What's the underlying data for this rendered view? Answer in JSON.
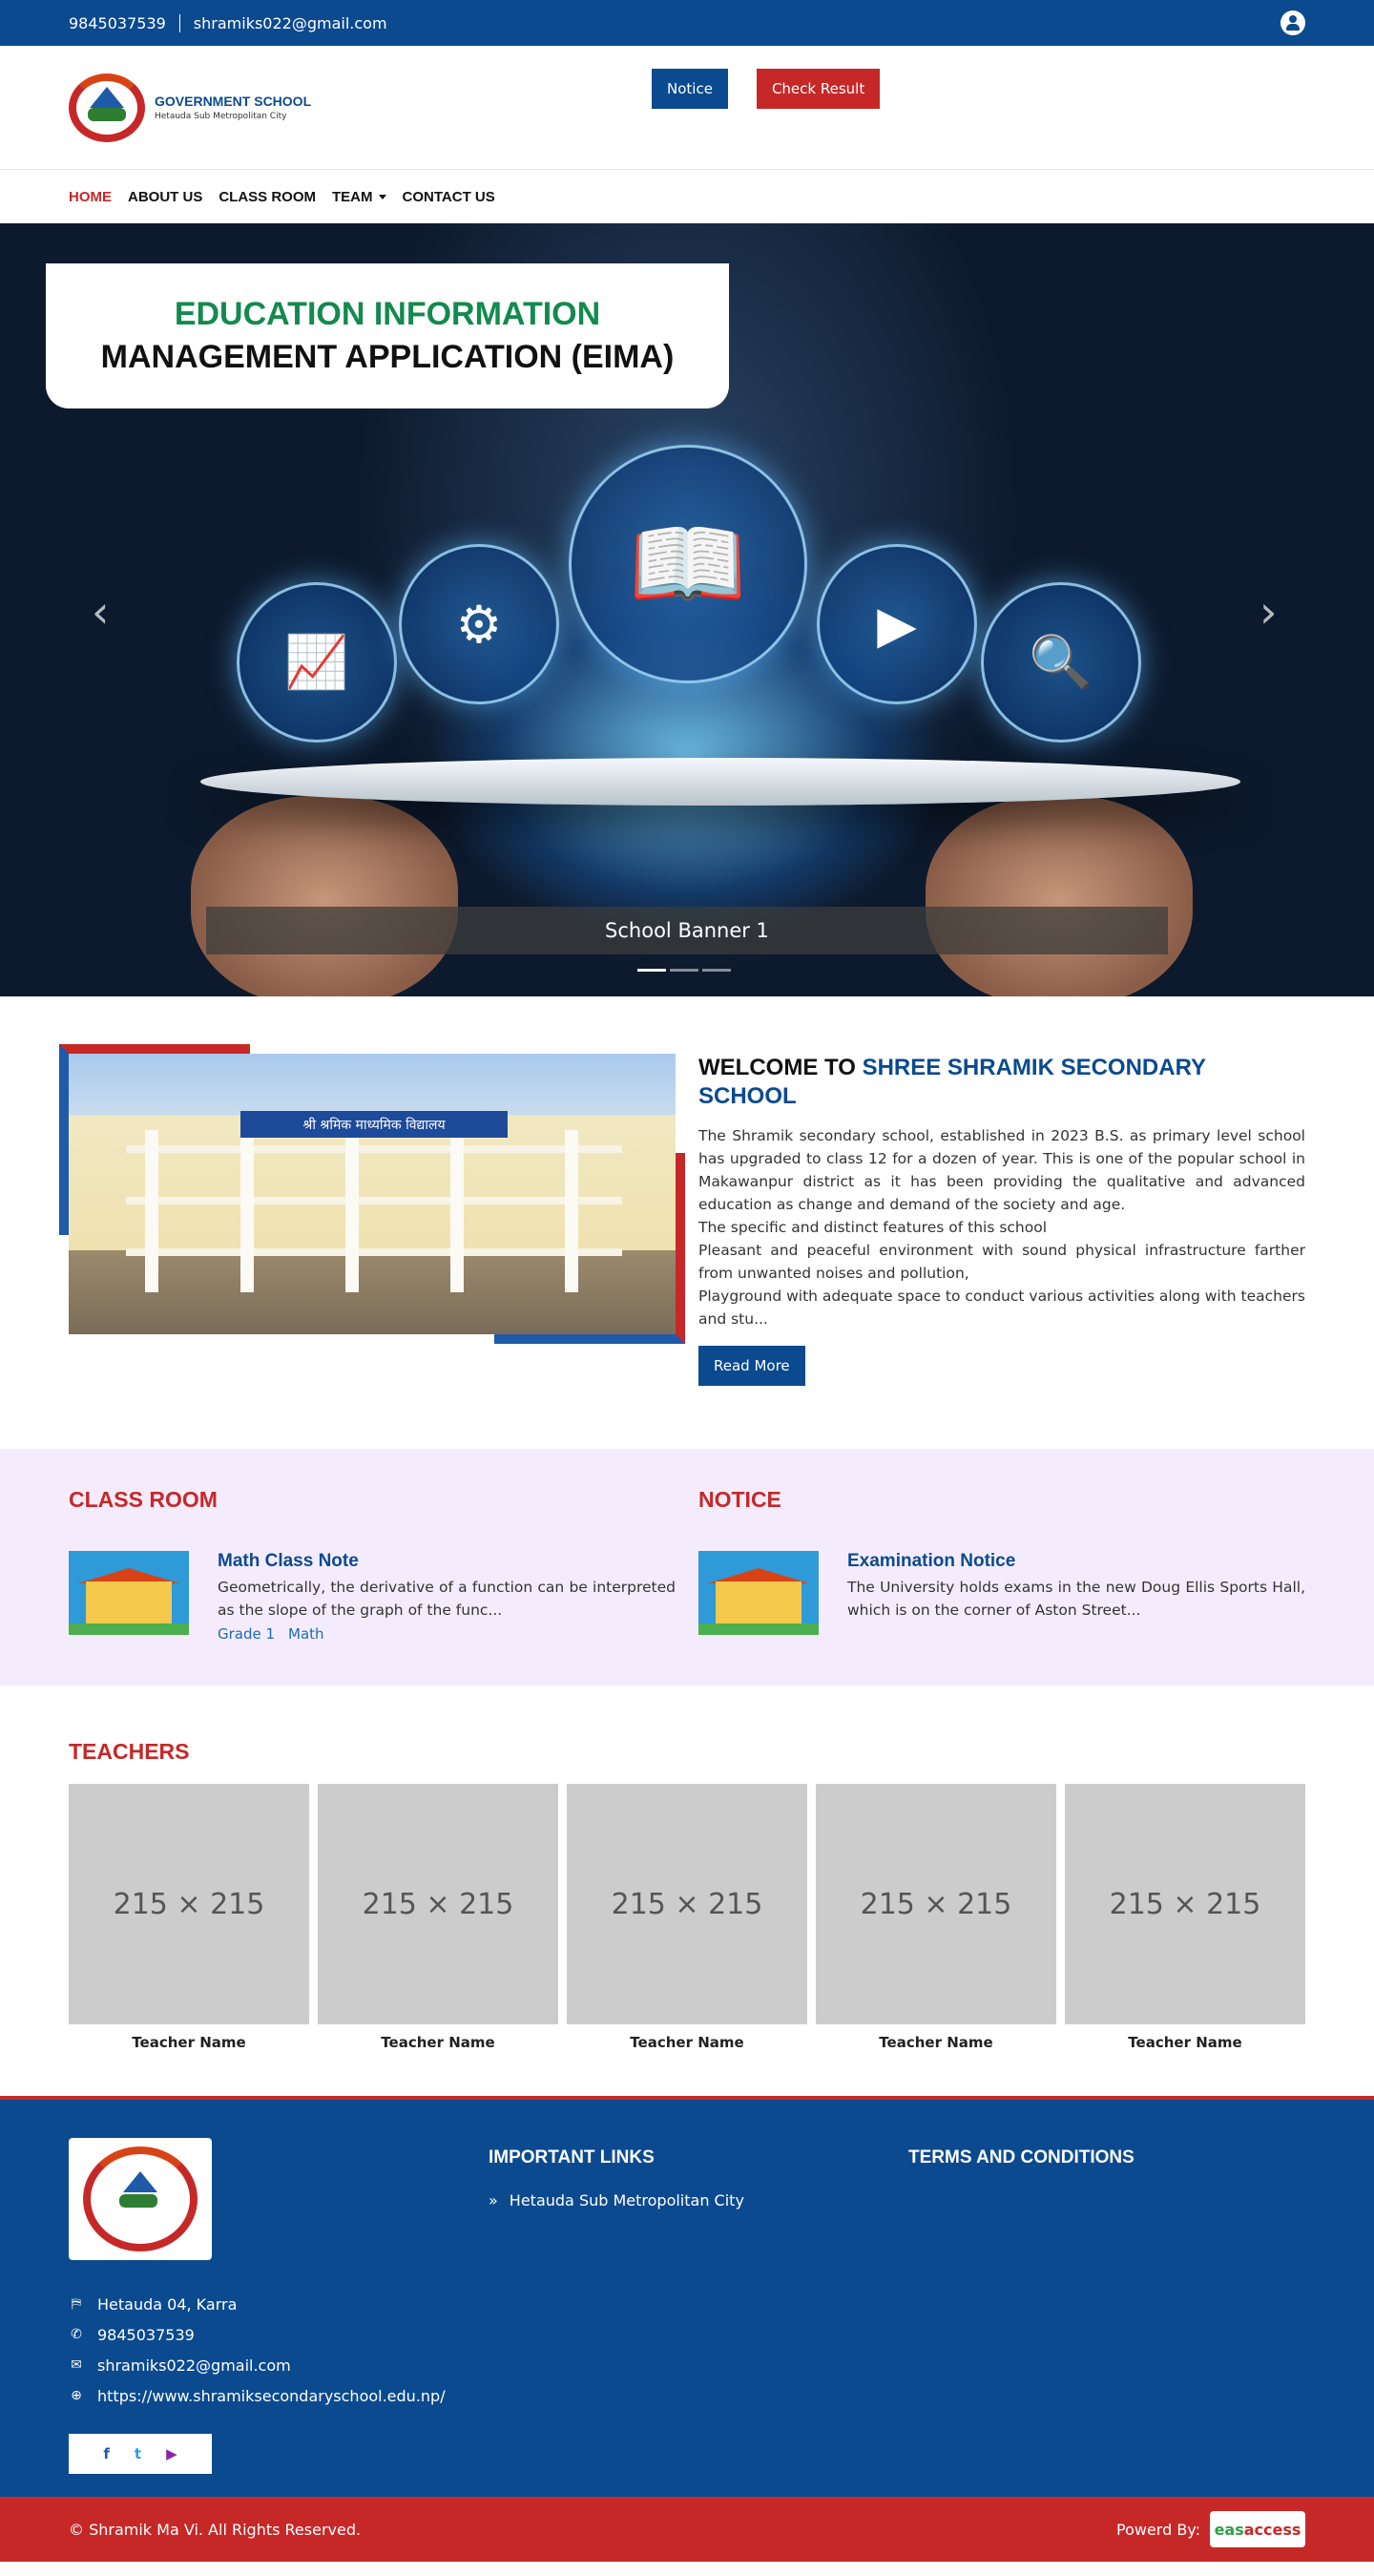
{
  "topbar": {
    "phone": "9845037539",
    "email": "shramiks022@gmail.com"
  },
  "header": {
    "logo_title": "GOVERNMENT SCHOOL",
    "logo_subtitle": "Hetauda Sub Metropolitan City",
    "notice_label": "Notice",
    "result_label": "Check Result"
  },
  "nav": {
    "home": "HOME",
    "about": "ABOUT US",
    "classroom": "CLASS ROOM",
    "team": "TEAM",
    "contact": "CONTACT US"
  },
  "hero": {
    "title_line1": "EDUCATION INFORMATION",
    "title_line2": "MANAGEMENT APPLICATION (EIMA)",
    "caption": "School Banner 1",
    "prev": "‹",
    "next": "›",
    "icons": [
      "chart-icon",
      "brain-gears-icon",
      "book-icon",
      "video-group-icon",
      "magnifier-icon"
    ]
  },
  "welcome": {
    "title_prefix": "WELCOME TO",
    "title_highlight": "SHREE SHRAMIK SECONDARY SCHOOL",
    "paragraph": "The Shramik secondary school, established in 2023 B.S. as primary level school has upgraded to class 12 for a dozen of year. This is one of the popular school in Makawanpur district as it has been providing the qualitative and advanced education as change and demand of the society and age.",
    "line2": "The specific and distinct features of this school",
    "line3": "Pleasant and peaceful environment with sound physical infrastructure farther from unwanted noises and pollution,",
    "line4": "Playground with adequate space to  conduct various activities along with teachers and stu...",
    "read_more": "Read More",
    "image_sign": "श्री श्रमिक माध्यमिक विद्यालय"
  },
  "classroom": {
    "title": "CLASS ROOM",
    "post_title": "Math Class Note",
    "post_text": "Geometrically, the derivative of a function can be interpreted as the slope of the graph of the func...",
    "tag1": "Grade 1",
    "tag2": "Math"
  },
  "notice": {
    "title": "NOTICE",
    "post_title": "Examination Notice",
    "post_text": "The University holds exams in the new Doug Ellis Sports Hall, which is on the corner of Aston Street..."
  },
  "teachers": {
    "title": "TEACHERS",
    "placeholder": "215 × 215",
    "names": [
      "Teacher Name",
      "Teacher Name",
      "Teacher Name",
      "Teacher Name",
      "Teacher Name"
    ]
  },
  "footer": {
    "address": "Hetauda 04, Karra",
    "phone": "9845037539",
    "email": "shramiks022@gmail.com",
    "website": "https://www.shramiksecondaryschool.edu.np/",
    "links_title": "IMPORTANT LINKS",
    "link1": "Hetauda Sub Metropolitan City",
    "terms_title": "TERMS AND CONDITIONS",
    "copyright": "© Shramik Ma Vi. All Rights Reserved.",
    "powered_by": "Powerd By:",
    "powered_logo_a": "eas",
    "powered_logo_b": "access"
  },
  "colors": {
    "primary": "#0b4a8f",
    "accent": "#c62828",
    "green": "#138a4e",
    "lavender": "#f4ecfd"
  }
}
